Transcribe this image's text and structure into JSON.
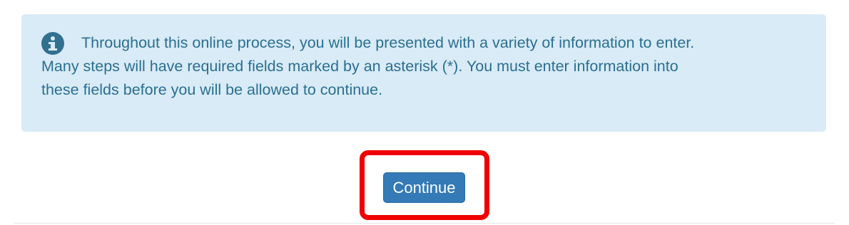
{
  "alert": {
    "icon": "info-circle-icon",
    "line1": "Throughout this online process, you will be presented with a variety of information to enter.",
    "line2": "Many steps will have required fields marked by an asterisk (*). You must enter information into",
    "line3": "these fields before you will be allowed to continue."
  },
  "actions": {
    "continue_label": "Continue"
  },
  "colors": {
    "alert_background": "#d9ebf6",
    "alert_text": "#2a6f92",
    "button_primary": "#337ab7",
    "highlight": "#f00000"
  }
}
